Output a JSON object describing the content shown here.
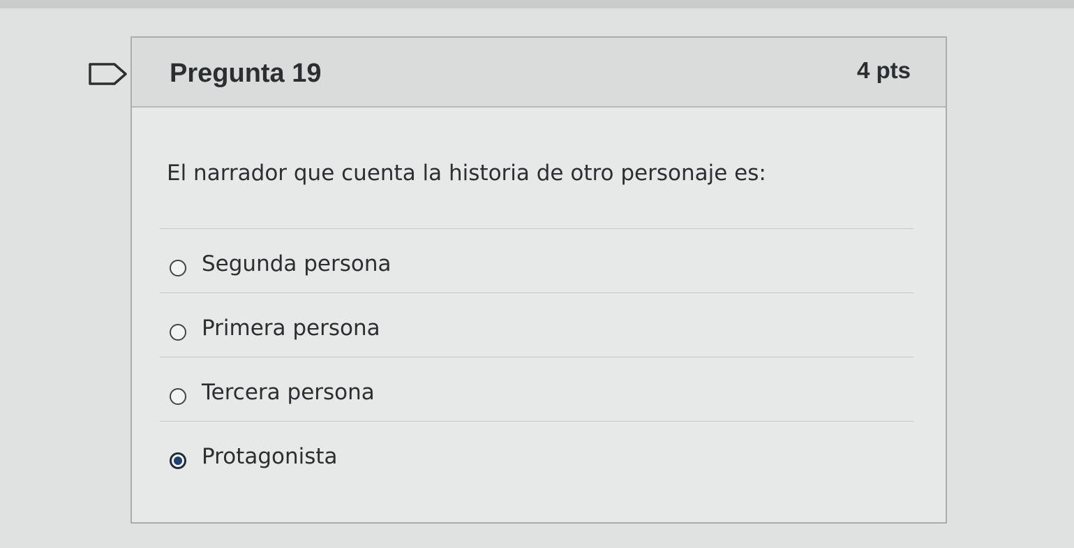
{
  "question": {
    "title": "Pregunta 19",
    "points": "4 pts",
    "text": "El narrador que cuenta la historia de otro personaje es:",
    "flag_icon": "flag-outline-icon"
  },
  "answers": [
    {
      "label": "Segunda persona",
      "selected": false
    },
    {
      "label": "Primera persona",
      "selected": false
    },
    {
      "label": "Tercera persona",
      "selected": false
    },
    {
      "label": "Protagonista",
      "selected": true
    }
  ],
  "colors": {
    "background": "#dfe2e1",
    "header": "#d9dcdb",
    "selected_radio": "#1d3f73",
    "text": "#2b2f31"
  }
}
